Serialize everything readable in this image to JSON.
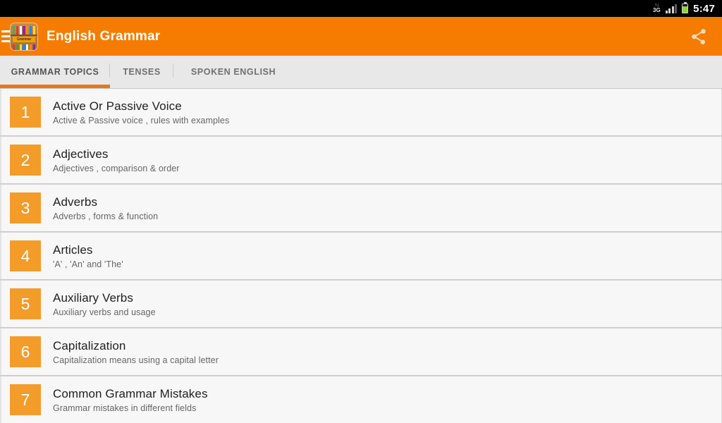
{
  "status_bar": {
    "data_arrows": "↑↓",
    "data_network": "3G",
    "signal_icon": "signal-bars-icon",
    "battery_icon": "battery-icon",
    "clock": "5:47"
  },
  "action_bar": {
    "menu_icon": "hamburger-menu-icon",
    "app_icon": "bookshelf-app-icon",
    "app_icon_label": "Grammar",
    "title": "English Grammar",
    "share_icon": "share-icon",
    "background_color": "#f57c00"
  },
  "tabs": {
    "items": [
      {
        "label": "GRAMMAR TOPICS",
        "active": true
      },
      {
        "label": "TENSES",
        "active": false
      },
      {
        "label": "SPOKEN ENGLISH",
        "active": false
      }
    ],
    "indicator_color": "#e8761b"
  },
  "list": {
    "accent_color": "#f39c2a",
    "rows": [
      {
        "number": "1",
        "title": "Active Or Passive Voice",
        "subtitle": "Active & Passive voice , rules with examples"
      },
      {
        "number": "2",
        "title": "Adjectives",
        "subtitle": "Adjectives , comparison & order"
      },
      {
        "number": "3",
        "title": "Adverbs",
        "subtitle": "Adverbs , forms & function"
      },
      {
        "number": "4",
        "title": "Articles",
        "subtitle": "'A' , 'An' and 'The'"
      },
      {
        "number": "5",
        "title": "Auxiliary Verbs",
        "subtitle": "Auxiliary verbs and usage"
      },
      {
        "number": "6",
        "title": "Capitalization",
        "subtitle": "Capitalization means using a capital letter"
      },
      {
        "number": "7",
        "title": "Common Grammar Mistakes",
        "subtitle": "Grammar mistakes in different fields"
      }
    ]
  }
}
